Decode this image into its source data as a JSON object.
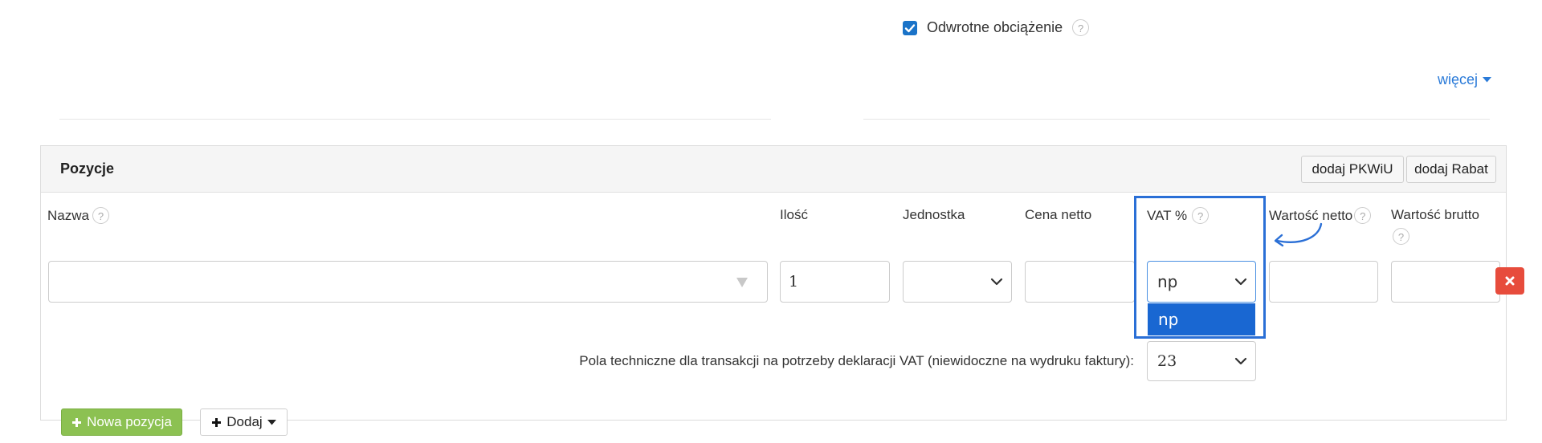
{
  "reverse_charge": {
    "label": "Odwrotne obciążenie",
    "checked": true
  },
  "more_link": "więcej",
  "positions": {
    "title": "Pozycje",
    "add_pkwiu": "dodaj PKWiU",
    "add_discount": "dodaj Rabat",
    "columns": {
      "name": "Nazwa",
      "quantity": "Ilość",
      "unit": "Jednostka",
      "net_price": "Cena netto",
      "vat": "VAT %",
      "net_value": "Wartość netto",
      "gross_value": "Wartość brutto"
    },
    "row": {
      "name_value": "",
      "quantity_value": "1",
      "unit_value": "",
      "net_price_value": "",
      "vat_value": "np",
      "net_value": "",
      "gross_value": ""
    },
    "vat_dropdown_option": "np",
    "tech_fields_label": "Pola techniczne dla transakcji na potrzeby deklaracji VAT (niewidoczne na wydruku faktury):",
    "tech_vat_value": "23",
    "new_position_button": "Nowa pozycja",
    "add_button": "Dodaj"
  },
  "help_glyph": "?",
  "colors": {
    "accent_blue": "#1a73c8",
    "highlight_blue": "#1967d2",
    "green": "#8cc152",
    "red": "#e74c3c"
  }
}
